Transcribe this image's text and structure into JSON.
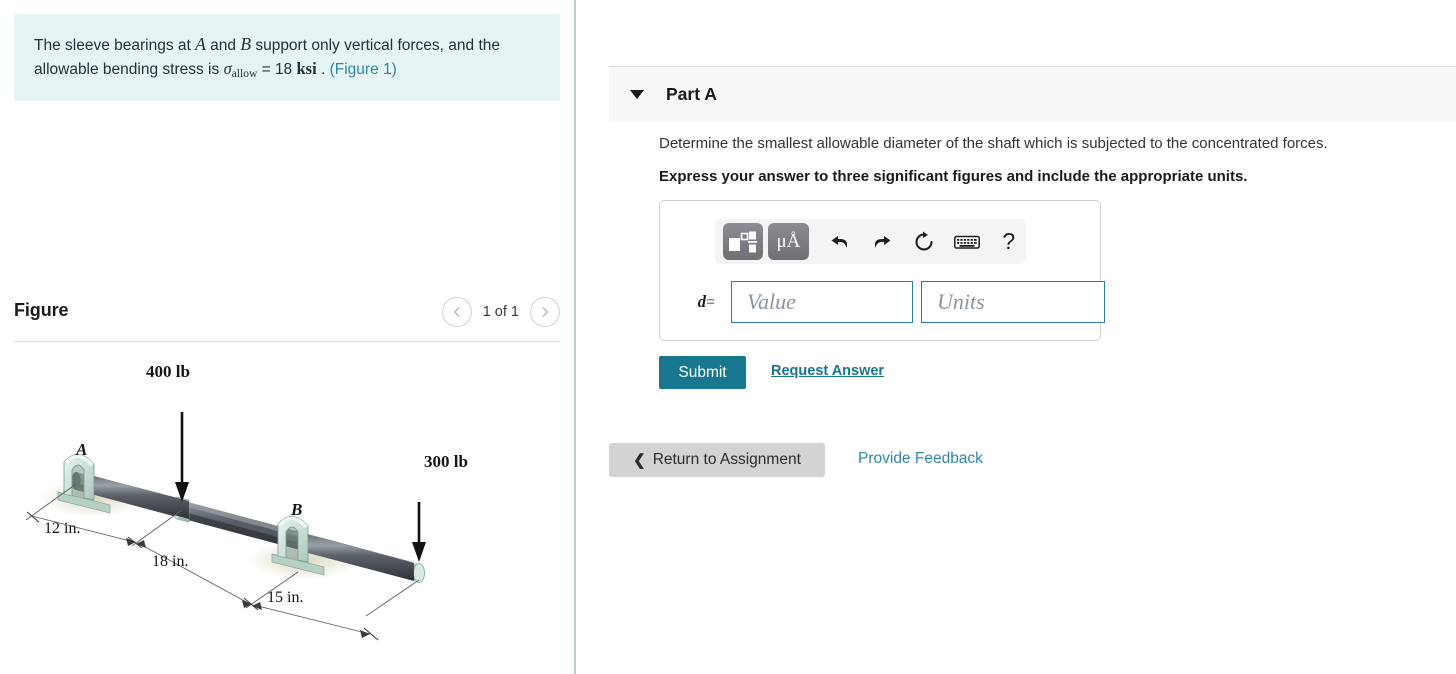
{
  "statement": {
    "part1": "The sleeve bearings at ",
    "var_a": "A",
    "part2": " and ",
    "var_b": "B",
    "part3": " support only vertical forces, and the allowable bending stress is ",
    "sigma": "σ",
    "sigma_sub": "allow",
    "equals": " = ",
    "value": "18",
    "unit": "ksi",
    "period": " . ",
    "figure_link": "(Figure 1)"
  },
  "figure": {
    "title": "Figure",
    "pager_count": "1 of 1",
    "prev_icon": "chevron-left-icon",
    "next_icon": "chevron-right-icon",
    "labels": {
      "force_left": "400 lb",
      "force_right": "300 lb",
      "point_a": "A",
      "point_b": "B",
      "dim1": "12 in.",
      "dim2": "18 in.",
      "dim3": "15 in."
    },
    "colors": {
      "shaft_dark": "#3a3d42",
      "shaft_light": "#8b9097",
      "bearing": "#cfe4dc",
      "bearing_edge": "#7fa395"
    }
  },
  "part_a": {
    "title": "Part A",
    "caret_icon": "caret-down-icon",
    "question": "Determine the smallest allowable diameter of the shaft which is subjected to the concentrated forces.",
    "instruction": "Express your answer to three significant figures and include the appropriate units.",
    "toolbar": {
      "template_icon": "math-template-icon",
      "units_label": "μÅ",
      "units_icon": "units-icon",
      "undo_icon": "undo-icon",
      "redo_icon": "redo-icon",
      "reset_icon": "reset-icon",
      "keyboard_icon": "keyboard-icon",
      "help_label": "?",
      "help_icon": "help-icon"
    },
    "answer": {
      "variable": "d",
      "equals": "=",
      "value_placeholder": "Value",
      "value": "",
      "units_placeholder": "Units",
      "units": ""
    },
    "submit_label": "Submit",
    "request_answer_label": "Request Answer"
  },
  "footer": {
    "return_label": "Return to Assignment",
    "return_icon": "chevron-left-icon",
    "feedback_label": "Provide Feedback"
  },
  "colors": {
    "accent_teal": "#17778f",
    "link_blue": "#2d87a8",
    "info_bg": "#e7f4f4",
    "panel_gray": "#f7f7f7",
    "button_gray": "#d3d3d3"
  }
}
